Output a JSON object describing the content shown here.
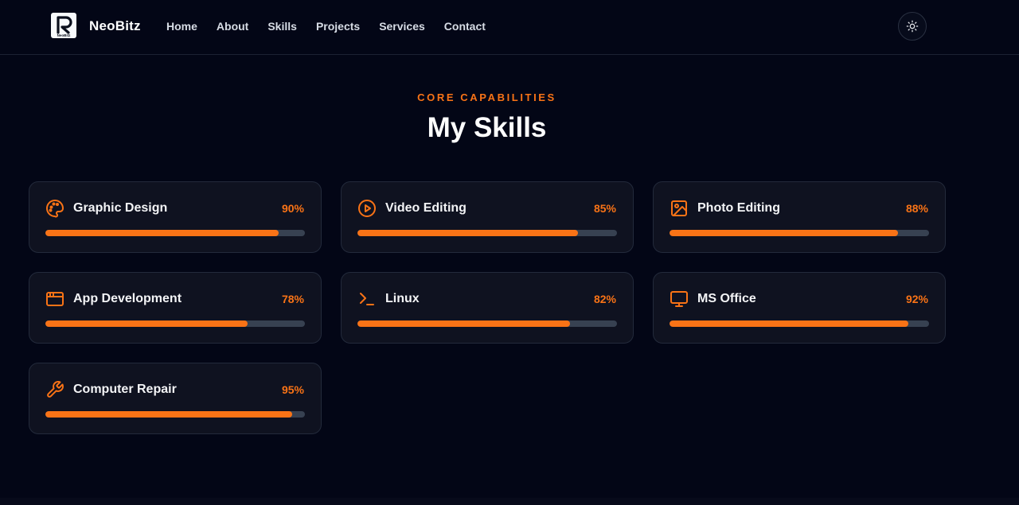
{
  "nav": {
    "brand": "NeoBitz",
    "logo_text": "NeoBitz",
    "links": [
      "Home",
      "About",
      "Skills",
      "Projects",
      "Services",
      "Contact"
    ],
    "theme_toggle_icon": "sun-icon"
  },
  "section": {
    "eyebrow": "CORE CAPABILITIES",
    "title": "My Skills"
  },
  "accent_color": "#f97316",
  "skills": [
    {
      "name": "Graphic Design",
      "percent_label": "90%",
      "percent": 90,
      "icon": "palette-icon"
    },
    {
      "name": "Video Editing",
      "percent_label": "85%",
      "percent": 85,
      "icon": "play-circle-icon"
    },
    {
      "name": "Photo Editing",
      "percent_label": "88%",
      "percent": 88,
      "icon": "image-icon"
    },
    {
      "name": "App Development",
      "percent_label": "78%",
      "percent": 78,
      "icon": "app-window-icon"
    },
    {
      "name": "Linux",
      "percent_label": "82%",
      "percent": 82,
      "icon": "terminal-icon"
    },
    {
      "name": "MS Office",
      "percent_label": "92%",
      "percent": 92,
      "icon": "monitor-icon"
    },
    {
      "name": "Computer Repair",
      "percent_label": "95%",
      "percent": 95,
      "icon": "wrench-icon"
    }
  ]
}
